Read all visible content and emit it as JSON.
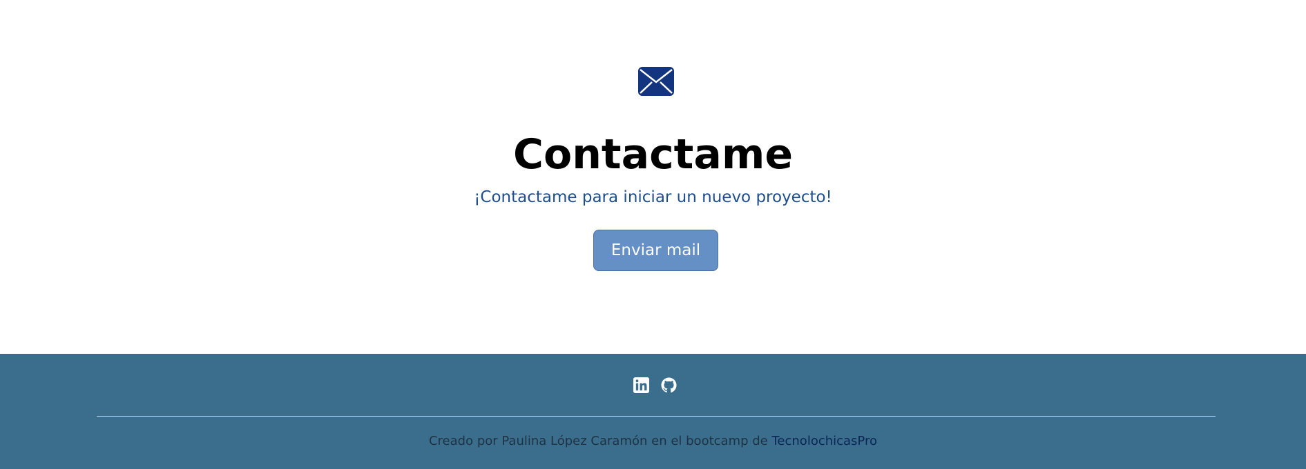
{
  "contact": {
    "icon": "envelope-icon",
    "title": "Contactame",
    "subtitle": "¡Contactame para iniciar un nuevo proyecto!",
    "button_label": "Enviar mail"
  },
  "footer": {
    "social": [
      {
        "icon": "linkedin-icon"
      },
      {
        "icon": "github-icon"
      }
    ],
    "credit_text": "Creado por Paulina López Caramón en el bootcamp de ",
    "credit_link": "TecnolochicasPro"
  },
  "colors": {
    "primary_dark": "#13347f",
    "subtitle": "#1f4e8c",
    "button_bg": "#6590c5",
    "footer_bg": "#3b6d8c",
    "link": "#0a2656"
  }
}
